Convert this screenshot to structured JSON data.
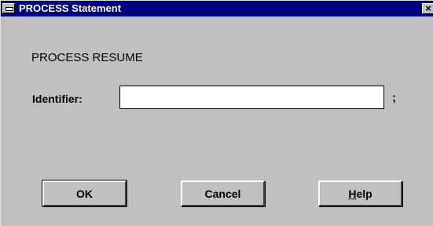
{
  "window": {
    "title": "PROCESS Statement",
    "close_label": "×"
  },
  "form": {
    "heading": "PROCESS RESUME",
    "identifier_label": "Identifier:",
    "identifier_value": "",
    "terminator": ";"
  },
  "buttons": {
    "ok_label": "OK",
    "cancel_label": "Cancel",
    "help_label_accel": "H",
    "help_label_rest": "elp"
  },
  "colors": {
    "titlebar": "#000080",
    "dialog_face": "#c0c0c0",
    "input_bg": "#ffffff"
  }
}
